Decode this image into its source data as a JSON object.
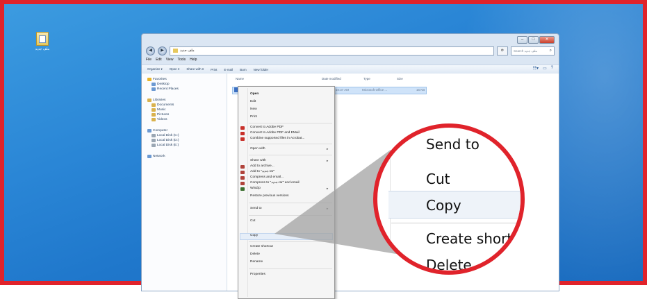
{
  "desktop": {
    "icon_label": "ملف جديد"
  },
  "window": {
    "address_path": "ملف جديد",
    "search_placeholder": "Search ملف جديد",
    "menu": [
      "File",
      "Edit",
      "View",
      "Tools",
      "Help"
    ],
    "toolbar": [
      "Organize ▾",
      "Open ▾",
      "Share with ▾",
      "Print",
      "E-mail",
      "Burn",
      "New folder"
    ],
    "nav": {
      "favorites": "Favorites",
      "desktop": "Desktop",
      "recent": "Recent Places",
      "libraries": "Libraries",
      "documents": "Documents",
      "music": "Music",
      "pictures": "Pictures",
      "videos": "Videos",
      "computer": "Computer",
      "disk_c": "Local Disk (C:)",
      "disk_d": "Local Disk (D:)",
      "disk_e": "Local Disk (E:)",
      "network": "Network"
    },
    "columns": {
      "name": "Name",
      "date": "Date modified",
      "type": "Type",
      "size": "Size"
    },
    "file": {
      "date": "10:37 AM",
      "type": "Microsoft Office ...",
      "size": "16 KB"
    }
  },
  "context_menu": {
    "open": "Open",
    "edit": "Edit",
    "new": "New",
    "print": "Print",
    "convert_pdf": "Convert to Adobe PDF",
    "convert_pdf_email": "Convert to Adobe PDF and EMail",
    "combine": "Combine supported files in Acrobat...",
    "open_with": "Open with",
    "share_with": "Share with",
    "add_archive": "Add to archive...",
    "add_rar": "Add to \"جديد.rar\"",
    "compress_email": "Compress and email...",
    "compress_rar_email": "Compress to \"جديد.rar\" and email",
    "winzip": "WinZip",
    "restore": "Restore previous versions",
    "send_to": "Send to",
    "cut": "Cut",
    "copy": "Copy",
    "create_shortcut": "Create shortcut",
    "delete": "Delete",
    "rename": "Rename",
    "properties": "Properties"
  },
  "zoom": {
    "send_to": "Send to",
    "cut": "Cut",
    "copy": "Copy",
    "create_shortcut": "Create short",
    "delete": "Delete"
  },
  "colors": {
    "frame": "#e0232b",
    "desktop": "#2a86d6",
    "selection": "#cfe3f9"
  }
}
